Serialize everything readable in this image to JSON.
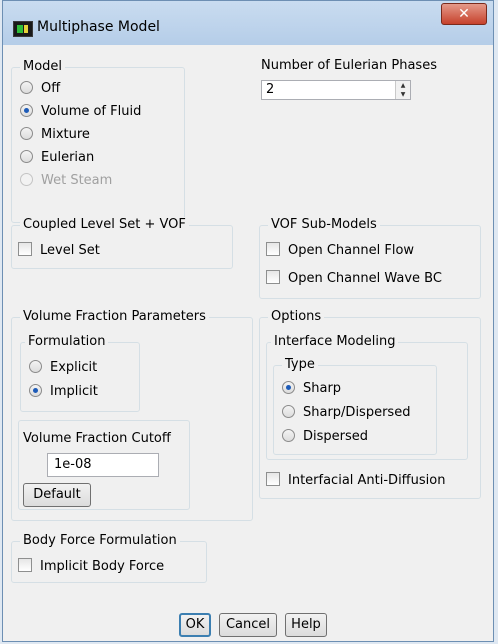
{
  "window": {
    "title": "Multiphase Model",
    "close_glyph": "✕"
  },
  "model": {
    "legend": "Model",
    "options": [
      {
        "label": "Off",
        "selected": false,
        "enabled": true
      },
      {
        "label": "Volume of Fluid",
        "selected": true,
        "enabled": true
      },
      {
        "label": "Mixture",
        "selected": false,
        "enabled": true
      },
      {
        "label": "Eulerian",
        "selected": false,
        "enabled": true
      },
      {
        "label": "Wet Steam",
        "selected": false,
        "enabled": false
      }
    ]
  },
  "eulerian_phases": {
    "label": "Number of Eulerian Phases",
    "value": "2"
  },
  "coupled": {
    "legend": "Coupled Level Set + VOF",
    "level_set": {
      "label": "Level Set",
      "checked": false
    }
  },
  "vof_submodels": {
    "legend": "VOF Sub-Models",
    "items": [
      {
        "label": "Open Channel Flow",
        "checked": false
      },
      {
        "label": "Open Channel Wave BC",
        "checked": false
      }
    ]
  },
  "vf_params": {
    "legend": "Volume Fraction Parameters",
    "formulation": {
      "legend": "Formulation",
      "options": [
        {
          "label": "Explicit",
          "selected": false
        },
        {
          "label": "Implicit",
          "selected": true
        }
      ]
    },
    "cutoff": {
      "label": "Volume Fraction Cutoff",
      "value": "1e-08",
      "default_label": "Default"
    }
  },
  "options": {
    "legend": "Options",
    "interface_modeling": {
      "legend": "Interface Modeling",
      "type": {
        "legend": "Type",
        "options": [
          {
            "label": "Sharp",
            "selected": true
          },
          {
            "label": "Sharp/Dispersed",
            "selected": false
          },
          {
            "label": "Dispersed",
            "selected": false
          }
        ]
      }
    },
    "anti_diffusion": {
      "label": "Interfacial Anti-Diffusion",
      "checked": false
    }
  },
  "body_force": {
    "legend": "Body Force Formulation",
    "implicit": {
      "label": "Implicit Body Force",
      "checked": false
    }
  },
  "buttons": {
    "ok": "OK",
    "cancel": "Cancel",
    "help": "Help"
  }
}
